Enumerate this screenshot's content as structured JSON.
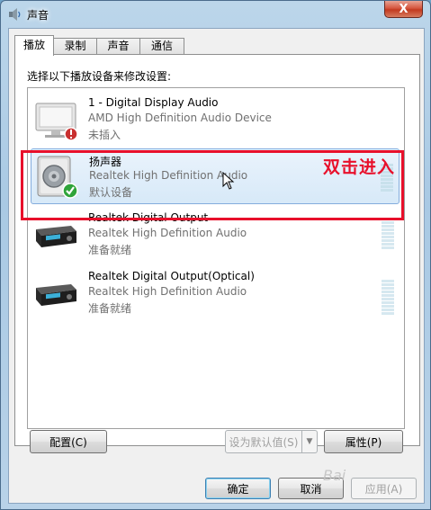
{
  "window": {
    "title": "声音",
    "close_label": "X"
  },
  "tabs": [
    {
      "label": "播放",
      "active": true
    },
    {
      "label": "录制",
      "active": false
    },
    {
      "label": "声音",
      "active": false
    },
    {
      "label": "通信",
      "active": false
    }
  ],
  "instruction": "选择以下播放设备来修改设置:",
  "devices": [
    {
      "name": "1 - Digital Display Audio",
      "driver": "AMD High Definition Audio Device",
      "status": "未插入",
      "icon": "monitor-icon",
      "badge": "unplugged-badge",
      "selected": false
    },
    {
      "name": "扬声器",
      "driver": "Realtek High Definition Audio",
      "status": "默认设备",
      "icon": "speaker-icon",
      "badge": "default-check-badge",
      "selected": true
    },
    {
      "name": "Realtek Digital Output",
      "driver": "Realtek High Definition Audio",
      "status": "准备就绪",
      "icon": "digital-receiver-icon",
      "selected": false
    },
    {
      "name": "Realtek Digital Output(Optical)",
      "driver": "Realtek High Definition Audio",
      "status": "准备就绪",
      "icon": "digital-receiver-icon",
      "selected": false
    }
  ],
  "annotation": {
    "text": "双击进入",
    "color": "#e8102b"
  },
  "buttons": {
    "configure": "配置(C)",
    "set_default": "设为默认值(S)",
    "properties": "属性(P)",
    "ok": "确定",
    "cancel": "取消",
    "apply": "应用(A)"
  },
  "watermark": "Bai"
}
